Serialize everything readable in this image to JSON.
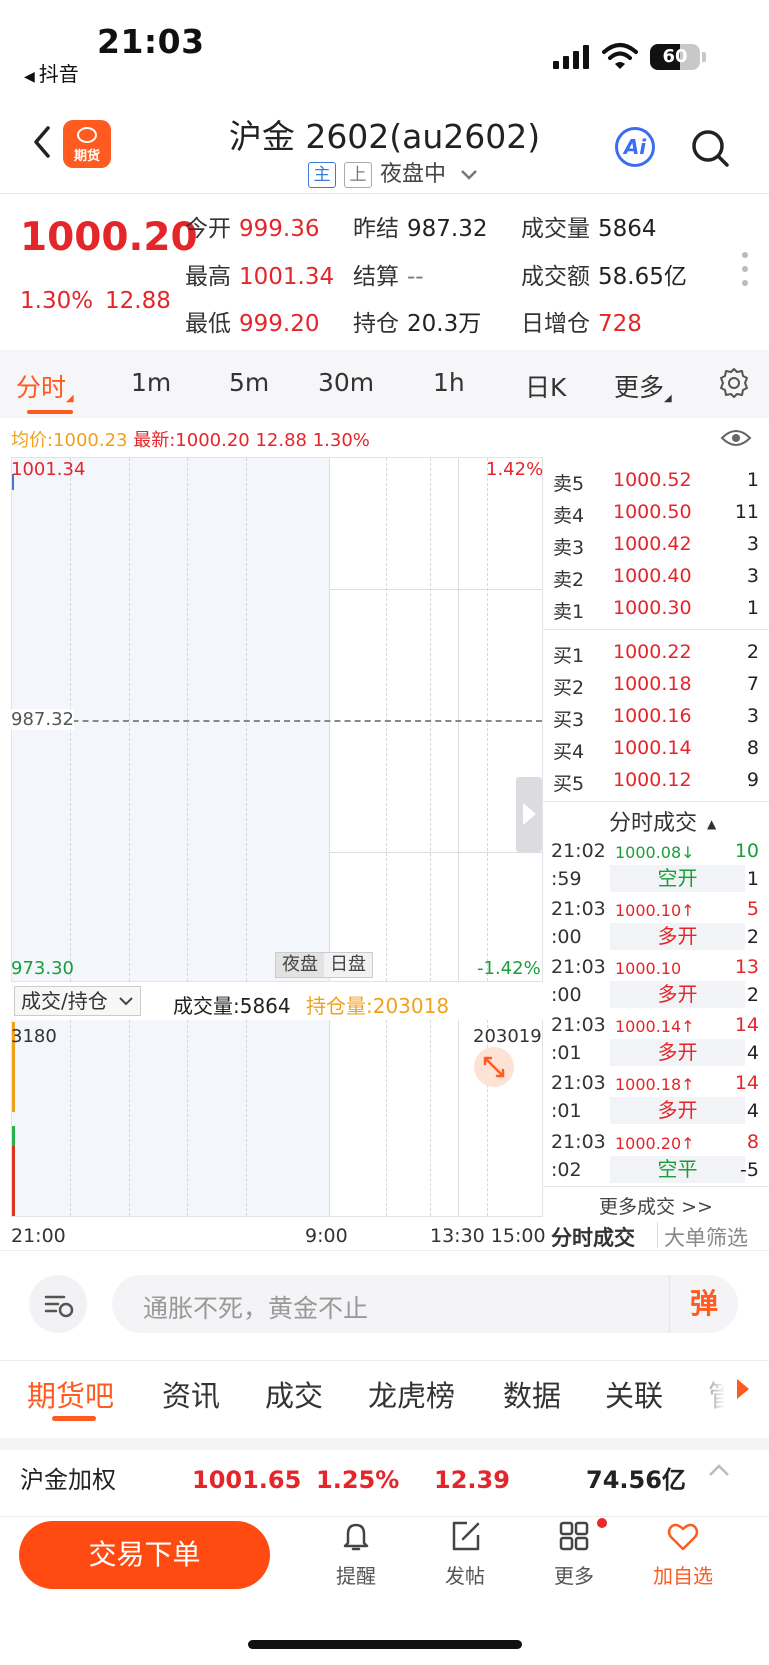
{
  "status_bar": {
    "time": "21:03",
    "back_app": "抖音",
    "battery": 60
  },
  "header": {
    "logo_text": "期货",
    "title": "沪金 2602(au2602)",
    "tag_main": "主",
    "tag_exchange": "上",
    "session": "夜盘中",
    "ai_label": "Ai"
  },
  "quote": {
    "last": "1000.20",
    "change_pct": "1.30%",
    "change_abs": "12.88",
    "open_label": "今开",
    "open": "999.36",
    "high_label": "最高",
    "high": "1001.34",
    "low_label": "最低",
    "low": "999.20",
    "prev_settle_label": "昨结",
    "prev_settle": "987.32",
    "settle_label": "结算",
    "settle": "--",
    "oi_label": "持仓",
    "oi": "20.3万",
    "volume_label": "成交量",
    "volume": "5864",
    "turnover_label": "成交额",
    "turnover": "58.65亿",
    "oi_change_label": "日增仓",
    "oi_change": "728"
  },
  "period_tabs": [
    "分时",
    "1m",
    "5m",
    "30m",
    "1h",
    "日K",
    "更多"
  ],
  "avg_info": {
    "avg": "均价:1000.23",
    "latest": "最新:1000.20 12.88 1.30%"
  },
  "chart": {
    "y_top": "1001.34",
    "y_mid": "987.32",
    "y_bottom": "973.30",
    "pct_top": "1.42%",
    "pct_bottom": "-1.42%",
    "session_night": "夜盘",
    "session_day": "日盘",
    "vol_select": "成交/持仓",
    "vol_text": "成交量:5864",
    "oi_text": "持仓量:203018",
    "vol_max": "3180",
    "oi_max": "203019",
    "time_start": "21:00",
    "time_mid": "9:00",
    "time_end": "13:30 15:00",
    "vol_level": 1.0
  },
  "orderbook": {
    "asks": [
      {
        "label": "卖5",
        "price": "1000.52",
        "qty": "1"
      },
      {
        "label": "卖4",
        "price": "1000.50",
        "qty": "11"
      },
      {
        "label": "卖3",
        "price": "1000.42",
        "qty": "3"
      },
      {
        "label": "卖2",
        "price": "1000.40",
        "qty": "3"
      },
      {
        "label": "卖1",
        "price": "1000.30",
        "qty": "1"
      }
    ],
    "bids": [
      {
        "label": "买1",
        "price": "1000.22",
        "qty": "2"
      },
      {
        "label": "买2",
        "price": "1000.18",
        "qty": "7"
      },
      {
        "label": "买3",
        "price": "1000.16",
        "qty": "3"
      },
      {
        "label": "买4",
        "price": "1000.14",
        "qty": "8"
      },
      {
        "label": "买5",
        "price": "1000.12",
        "qty": "9"
      }
    ]
  },
  "trades": {
    "title": "分时成交",
    "rows": [
      {
        "time": "21:02",
        "sec": ":59",
        "price": "1000.08↓",
        "qty": "10",
        "type": "空开",
        "type_qty": "1",
        "dir": "down"
      },
      {
        "time": "21:03",
        "sec": ":00",
        "price": "1000.10↑",
        "qty": "5",
        "type": "多开",
        "type_qty": "2",
        "dir": "up"
      },
      {
        "time": "21:03",
        "sec": ":00",
        "price": "1000.10",
        "qty": "13",
        "type": "多开",
        "type_qty": "2",
        "dir": "up"
      },
      {
        "time": "21:03",
        "sec": ":01",
        "price": "1000.14↑",
        "qty": "14",
        "type": "多开",
        "type_qty": "4",
        "dir": "up"
      },
      {
        "time": "21:03",
        "sec": ":01",
        "price": "1000.18↑",
        "qty": "14",
        "type": "多开",
        "type_qty": "4",
        "dir": "up"
      },
      {
        "time": "21:03",
        "sec": ":02",
        "price": "1000.20↑",
        "qty": "8",
        "type": "空平",
        "type_qty": "-5",
        "dir": "down"
      }
    ],
    "more": "更多成交 >>",
    "tab_trades": "分时成交",
    "tab_big": "大单筛选"
  },
  "comment": {
    "placeholder": "通胀不死，黄金不止",
    "danmaku": "弹"
  },
  "content_tabs": [
    "期货吧",
    "资讯",
    "成交",
    "龙虎榜",
    "数据",
    "关联",
    "管"
  ],
  "related": {
    "name": "沪金加权",
    "price": "1001.65",
    "pct": "1.25%",
    "chg": "12.39",
    "amount": "74.56亿"
  },
  "bottom_bar": {
    "trade": "交易下单",
    "alert": "提醒",
    "post": "发帖",
    "more": "更多",
    "watch": "加自选"
  },
  "colors": {
    "up": "#e4262b",
    "down": "#1a9e3a",
    "accent": "#ff5a1f",
    "oi": "#f0a21c"
  }
}
